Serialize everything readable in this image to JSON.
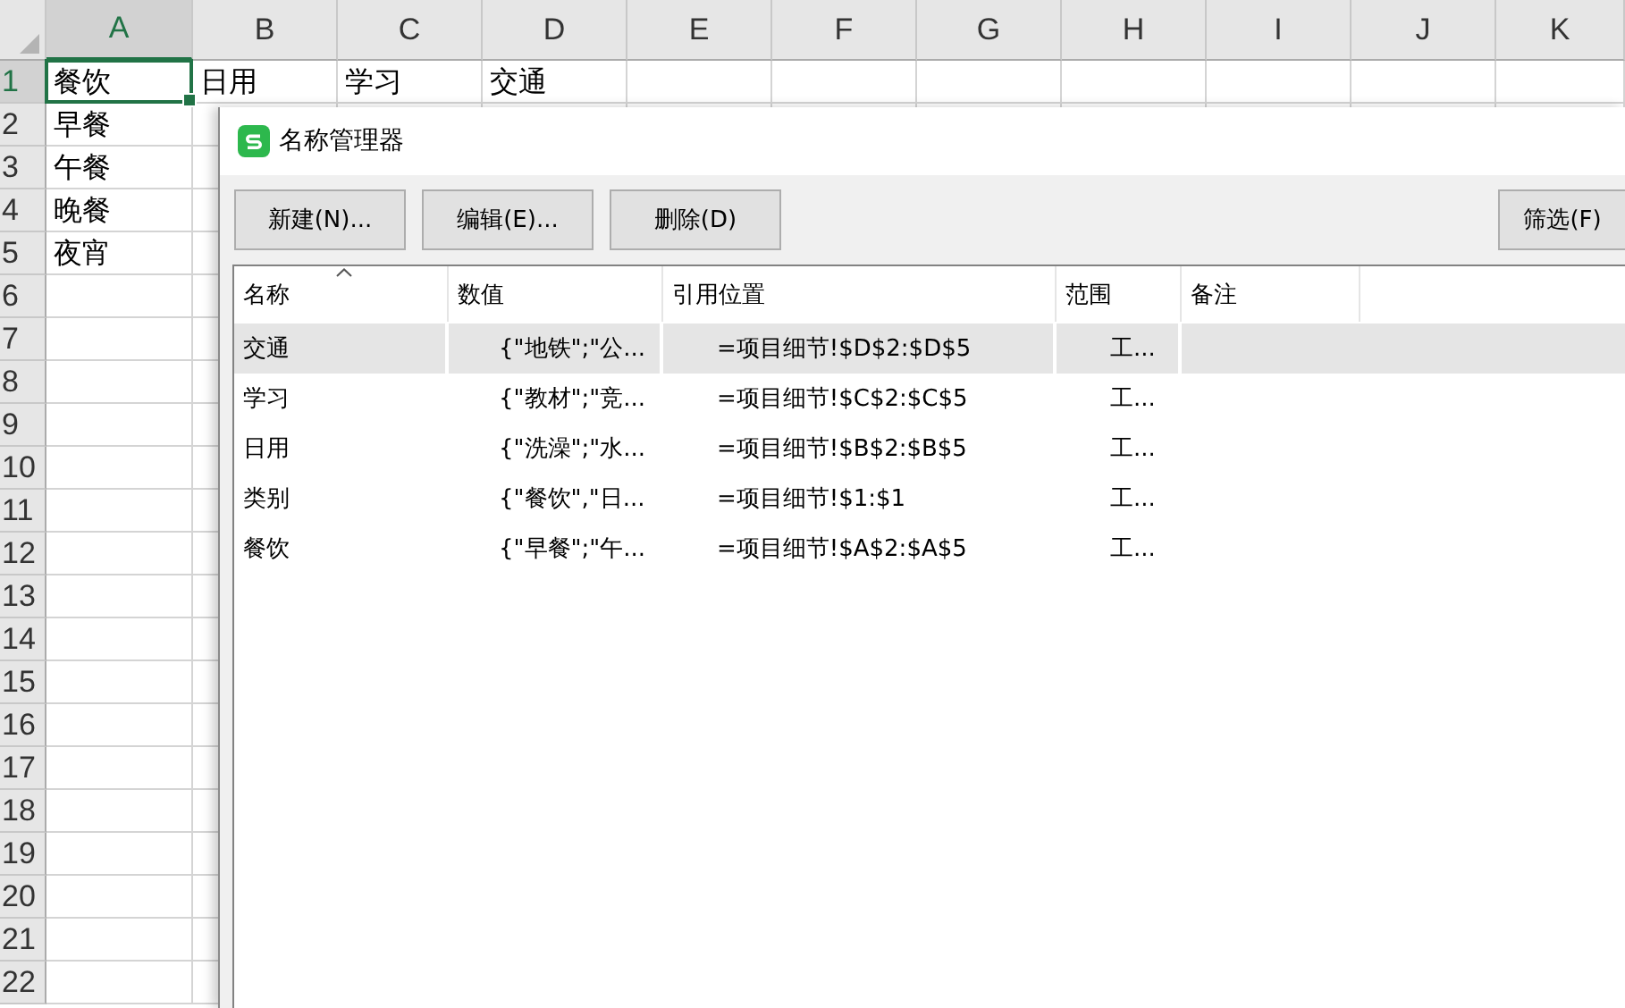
{
  "sheet": {
    "columns": [
      {
        "label": "A",
        "selected": true
      },
      {
        "label": "B",
        "selected": false
      },
      {
        "label": "C",
        "selected": false
      },
      {
        "label": "D",
        "selected": false
      },
      {
        "label": "E",
        "selected": false
      },
      {
        "label": "F",
        "selected": false
      },
      {
        "label": "G",
        "selected": false
      },
      {
        "label": "H",
        "selected": false
      },
      {
        "label": "I",
        "selected": false
      },
      {
        "label": "J",
        "selected": false
      },
      {
        "label": "K",
        "selected": false
      }
    ],
    "rows": [
      {
        "label": "1",
        "selected": true,
        "cells": [
          "餐饮",
          "日用",
          "学习",
          "交通"
        ]
      },
      {
        "label": "2",
        "selected": false,
        "cells": [
          "早餐"
        ]
      },
      {
        "label": "3",
        "selected": false,
        "cells": [
          "午餐"
        ]
      },
      {
        "label": "4",
        "selected": false,
        "cells": [
          "晚餐"
        ]
      },
      {
        "label": "5",
        "selected": false,
        "cells": [
          "夜宵"
        ]
      },
      {
        "label": "6",
        "selected": false
      },
      {
        "label": "7",
        "selected": false
      },
      {
        "label": "8",
        "selected": false
      },
      {
        "label": "9",
        "selected": false
      },
      {
        "label": "10",
        "selected": false
      },
      {
        "label": "11",
        "selected": false
      },
      {
        "label": "12",
        "selected": false
      },
      {
        "label": "13",
        "selected": false
      },
      {
        "label": "14",
        "selected": false
      },
      {
        "label": "15",
        "selected": false
      },
      {
        "label": "16",
        "selected": false
      },
      {
        "label": "17",
        "selected": false
      },
      {
        "label": "18",
        "selected": false
      },
      {
        "label": "19",
        "selected": false
      },
      {
        "label": "20",
        "selected": false
      },
      {
        "label": "21",
        "selected": false
      },
      {
        "label": "22",
        "selected": false
      }
    ]
  },
  "dialog": {
    "title": "名称管理器",
    "buttons": [
      "新建(N)...",
      "编辑(E)...",
      "删除(D)"
    ],
    "filter_button": "筛选(F)",
    "list": {
      "columns": [
        {
          "label": "名称",
          "sorted": true
        },
        {
          "label": "数值",
          "sorted": false
        },
        {
          "label": "引用位置",
          "sorted": false
        },
        {
          "label": "范围",
          "sorted": false
        },
        {
          "label": "备注",
          "sorted": false
        }
      ],
      "rows": [
        {
          "selected": true,
          "cells": [
            "交通",
            "{\"地铁\";\"公...",
            "=项目细节!$D$2:$D$5",
            "工..."
          ]
        },
        {
          "selected": false,
          "cells": [
            "学习",
            "{\"教材\";\"竞...",
            "=项目细节!$C$2:$C$5",
            "工..."
          ]
        },
        {
          "selected": false,
          "cells": [
            "日用",
            "{\"洗澡\";\"水...",
            "=项目细节!$B$2:$B$5",
            "工..."
          ]
        },
        {
          "selected": false,
          "cells": [
            "类别",
            "{\"餐饮\",\"日...",
            "=项目细节!$1:$1",
            "工..."
          ]
        },
        {
          "selected": false,
          "cells": [
            "餐饮",
            "{\"早餐\";\"午...",
            "=项目细节!$A$2:$A$5",
            "工..."
          ]
        }
      ]
    }
  }
}
